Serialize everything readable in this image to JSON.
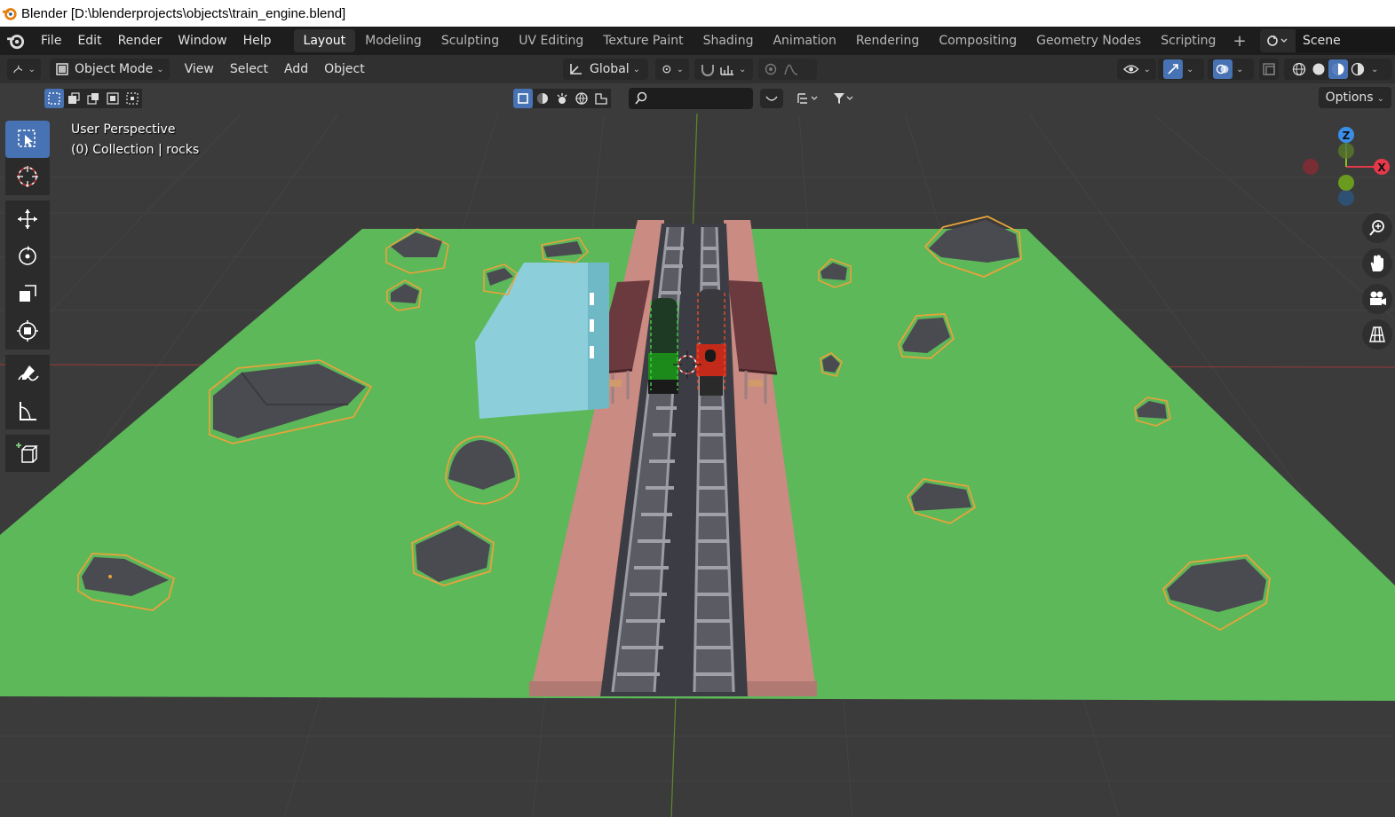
{
  "window": {
    "title": "Blender [D:\\blenderprojects\\objects\\train_engine.blend]"
  },
  "menus": [
    "File",
    "Edit",
    "Render",
    "Window",
    "Help"
  ],
  "workspaces": [
    "Layout",
    "Modeling",
    "Sculpting",
    "UV Editing",
    "Texture Paint",
    "Shading",
    "Animation",
    "Rendering",
    "Compositing",
    "Geometry Nodes",
    "Scripting"
  ],
  "active_workspace": "Layout",
  "scene": {
    "name": "Scene",
    "icon": "scene-icon"
  },
  "header": {
    "mode": "Object Mode",
    "menus": [
      "View",
      "Select",
      "Add",
      "Object"
    ],
    "transform_orientation": "Global",
    "options_label": "Options"
  },
  "search": {
    "placeholder": ""
  },
  "viewport": {
    "perspective_label": "User Perspective",
    "collection_label": "(0) Collection | rocks"
  },
  "gizmo": {
    "z": "Z",
    "x": "X"
  },
  "tools": [
    "select-box-icon",
    "cursor-icon",
    "move-icon",
    "rotate-icon",
    "scale-icon",
    "transform-icon",
    "annotate-icon",
    "measure-icon",
    "add-cube-icon"
  ],
  "colors": {
    "accent": "#4772b3",
    "ground": "#5db85a",
    "platform": "#c98b82",
    "rock": "#4a4b50",
    "rock_outline": "#e8a33b",
    "building": "#8ccfdb",
    "engine_green": "#1b8a1b",
    "engine_red": "#c42a1a",
    "gizmo_x": "#e5394a",
    "gizmo_y": "#8bbf2a",
    "gizmo_z": "#3b8ee8"
  }
}
